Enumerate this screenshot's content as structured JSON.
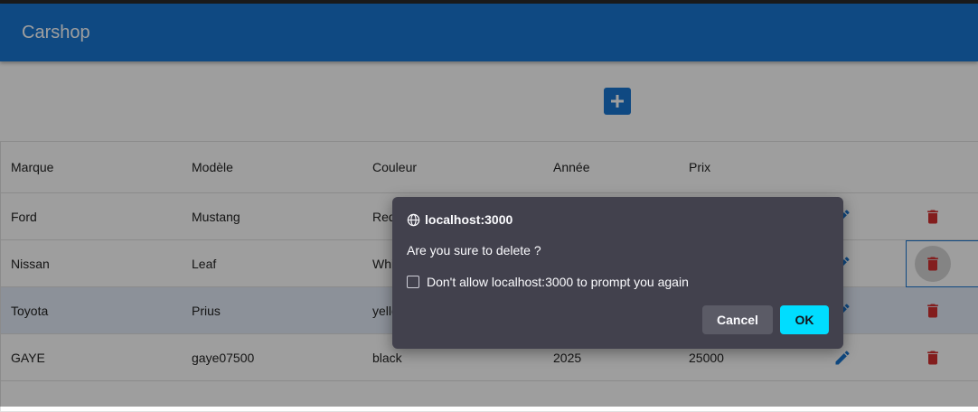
{
  "app": {
    "title": "Carshop"
  },
  "colors": {
    "primary": "#1976d2",
    "delete": "#d32f2f",
    "dialog_bg": "#42414d",
    "ok_button": "#00ddff"
  },
  "toolbar": {
    "add_icon": "plus-icon"
  },
  "table": {
    "columns": [
      "Marque",
      "Modèle",
      "Couleur",
      "Année",
      "Prix"
    ],
    "rows": [
      {
        "brand": "Ford",
        "model": "Mustang",
        "color": "Red",
        "year": "",
        "price": ""
      },
      {
        "brand": "Nissan",
        "model": "Leaf",
        "color": "White",
        "year": "",
        "price": ""
      },
      {
        "brand": "Toyota",
        "model": "Prius",
        "color": "yellow",
        "year": "",
        "price": ""
      },
      {
        "brand": "GAYE",
        "model": "gaye07500",
        "color": "black",
        "year": "2025",
        "price": "25000"
      }
    ],
    "row_icons": {
      "edit": "pencil-icon",
      "delete": "trash-icon"
    }
  },
  "dialog": {
    "origin": "localhost:3000",
    "message": "Are you sure to delete ?",
    "checkbox_label": "Don't allow localhost:3000 to prompt you again",
    "cancel_label": "Cancel",
    "ok_label": "OK"
  }
}
